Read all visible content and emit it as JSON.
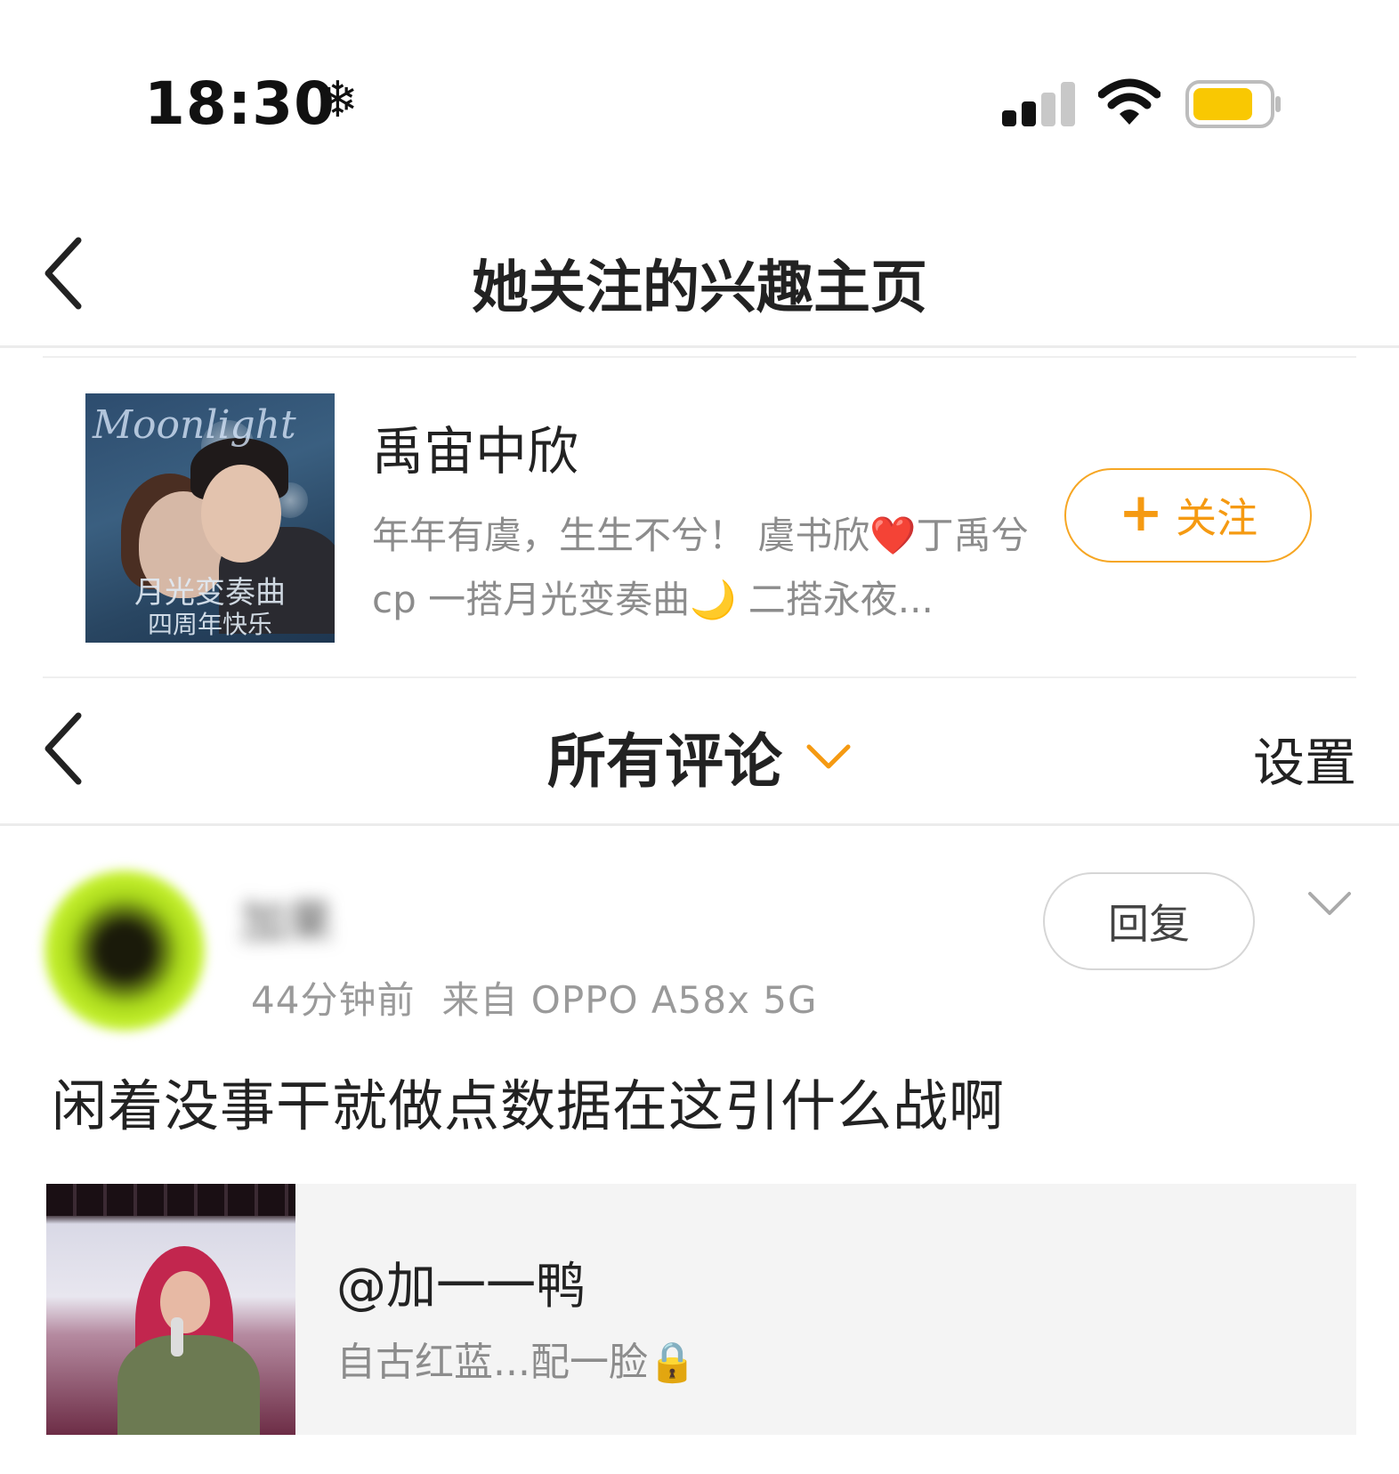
{
  "status_bar": {
    "time": "18:30",
    "snow_glyph": "❄",
    "icons": [
      "snowflake-icon",
      "signal-icon",
      "wifi-icon",
      "battery-icon"
    ],
    "battery_color": "#f9c802"
  },
  "header": {
    "title": "她关注的兴趣主页",
    "back_icon": "chevron-left-icon"
  },
  "interest": {
    "name": "禹宙中欣",
    "description_part1": "年年有虞，生生不兮！ 虞书欣",
    "heart": "❤️",
    "description_part2": "丁禹兮cp 一搭月光变奏曲",
    "moon": "🌙",
    "description_part3": " 二搭永夜...",
    "cover_script": "Moonlight",
    "cover_line1": "月光变奏曲",
    "cover_line2": "四周年快乐",
    "follow_plus": "+",
    "follow_label": "关注",
    "accent_color": "#f59a12"
  },
  "comments_header": {
    "title": "所有评论",
    "dropdown_icon": "chevron-down-icon",
    "settings_label": "设置"
  },
  "comment": {
    "username": "加果",
    "time_ago": "44分钟前",
    "source": "来自 OPPO A58x 5G",
    "reply_label": "回复",
    "text": "闲着没事干就做点数据在这引什么战啊",
    "quote": {
      "user": "@加一一鸭",
      "text": "自古红蓝...配一脸",
      "lock": "🔒"
    }
  }
}
